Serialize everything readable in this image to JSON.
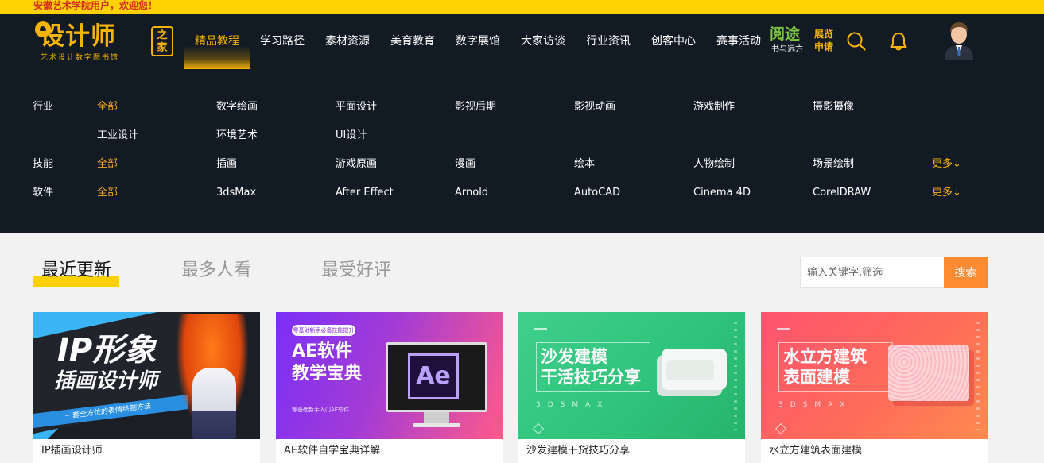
{
  "welcome_text": "安徽艺术学院用户，欢迎您！",
  "logo": {
    "main": "设计师",
    "box": "之家",
    "sub": "艺术设计数字图书馆"
  },
  "nav": {
    "items": [
      "精品教程",
      "学习路径",
      "素材资源",
      "美育教育",
      "数字展馆",
      "大家访谈",
      "行业资讯",
      "创客中心",
      "赛事活动"
    ]
  },
  "promo": {
    "big": "阅途",
    "small": "书与远方",
    "side": "展览申请"
  },
  "header_icons": [
    "search-icon",
    "bell-icon",
    "user-avatar"
  ],
  "categories": {
    "industry_label": "行业",
    "industry_row1": [
      "全部",
      "数字绘画",
      "平面设计",
      "影视后期",
      "影视动画",
      "游戏制作",
      "摄影摄像"
    ],
    "industry_row2": [
      "工业设计",
      "环境艺术",
      "UI设计"
    ],
    "skill_label": "技能",
    "skills": [
      "全部",
      "插画",
      "游戏原画",
      "漫画",
      "绘本",
      "人物绘制",
      "场景绘制"
    ],
    "skill_more": "更多↓",
    "software_label": "软件",
    "software": [
      "全部",
      "3dsMax",
      "After Effect",
      "Arnold",
      "AutoCAD",
      "Cinema 4D",
      "CorelDRAW"
    ],
    "software_more": "更多↓"
  },
  "tabs": [
    "最近更新",
    "最多人看",
    "最受好评"
  ],
  "search": {
    "placeholder": "输入关键字,筛选",
    "button": "搜索"
  },
  "cards": [
    {
      "title": "IP插画设计师",
      "thumb_line1": "IP形象",
      "thumb_line2": "插画设计师",
      "thumb_ribbon": "一套全方位的表情绘制方法"
    },
    {
      "title": "AE软件自学宝典详解",
      "thumb_pill": "零基础新手必备技能提升",
      "thumb_line1": "AE软件",
      "thumb_line2": "教学宝典",
      "thumb_foot": "零基础新手入门AE软件",
      "thumb_logo": "Ae"
    },
    {
      "title": "沙发建模干货技巧分享",
      "thumb_line1": "沙发建模",
      "thumb_line2": "干活技巧分享",
      "thumb_sub": "3DSMAX"
    },
    {
      "title": "水立方建筑表面建模",
      "thumb_line1": "水立方建筑",
      "thumb_line2": "表面建模",
      "thumb_sub": "3DSMAX"
    }
  ],
  "colors": {
    "accent": "#f5b400",
    "topbar": "#ffd100",
    "header_bg": "#121a24",
    "selected": "#f5a623",
    "search_button": "#ff8c33"
  }
}
